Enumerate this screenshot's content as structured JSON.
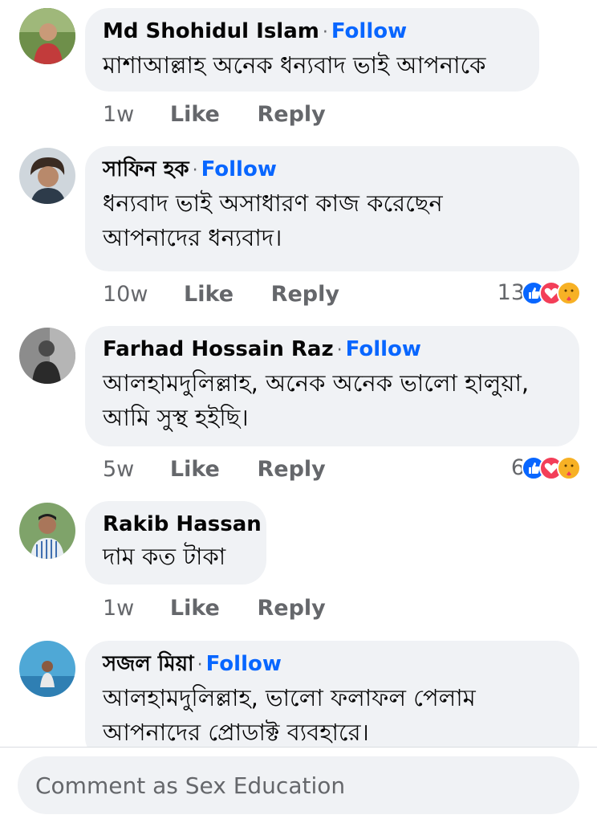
{
  "comments": [
    {
      "name": "Md Shohidul Islam",
      "follow": "Follow",
      "text_lines": [
        "মাশাআল্লাহ অনেক ধন্যবাদ ভাই আপনাকে"
      ],
      "time": "1w",
      "like": "Like",
      "reply": "Reply",
      "reaction_count": ""
    },
    {
      "name": "সাফিন হক",
      "follow": "Follow",
      "text_lines": [
        "ধন্যবাদ ভাই অসাধারণ কাজ করেছেন",
        "আপনাদের ধন্যবাদ।"
      ],
      "time": "10w",
      "like": "Like",
      "reply": "Reply",
      "reaction_count": "13"
    },
    {
      "name": "Farhad Hossain Raz",
      "follow": "Follow",
      "text_lines": [
        "আলহামদুলিল্লাহ, অনেক অনেক ভালো হালুয়া,",
        "আমি সুস্থ হইছি।"
      ],
      "time": "5w",
      "like": "Like",
      "reply": "Reply",
      "reaction_count": "6"
    },
    {
      "name": "Rakib Hassan",
      "follow": "",
      "text_lines": [
        "দাম কত টাকা"
      ],
      "time": "1w",
      "like": "Like",
      "reply": "Reply",
      "reaction_count": ""
    },
    {
      "name": "সজল মিয়া",
      "follow": "Follow",
      "text_lines": [
        "আলহামদুলিল্লাহ,  ভালো ফলাফল পেলাম",
        "আপনাদের প্রোডাক্ট ব্যবহারে।"
      ],
      "time": "",
      "like": "",
      "reply": "",
      "reaction_count": ""
    }
  ],
  "reaction_icons": [
    "like-icon",
    "love-icon",
    "care-icon"
  ],
  "colors": {
    "bubble": "#f0f2f5",
    "follow": "#0866ff",
    "secondary_text": "#65676b",
    "like_reaction": "#0866ff",
    "love_reaction": "#f33e58",
    "care_reaction": "#f7b125"
  },
  "composer": {
    "placeholder": "Comment as Sex Education"
  }
}
